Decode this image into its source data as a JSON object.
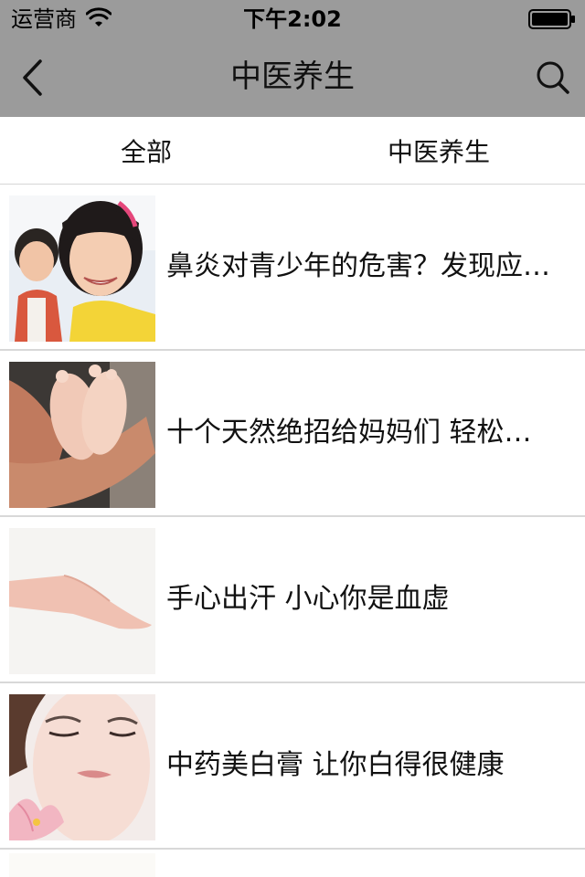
{
  "status_bar": {
    "carrier": "运营商",
    "time": "下午2:02"
  },
  "nav": {
    "title": "中医养生",
    "back_icon": "chevron-left-icon",
    "search_icon": "search-icon"
  },
  "tabs": [
    {
      "label": "全部"
    },
    {
      "label": "中医养生"
    }
  ],
  "articles": [
    {
      "title": "鼻炎对青少年的危害？发现应…",
      "thumbnail": "children-smiling"
    },
    {
      "title": "十个天然绝招给妈妈们 轻松…",
      "thumbnail": "baby-feet-in-hands"
    },
    {
      "title": "手心出汗 小心你是血虚",
      "thumbnail": "open-palm-hand"
    },
    {
      "title": "中药美白膏 让你白得很健康",
      "thumbnail": "woman-face-with-lily"
    }
  ],
  "colors": {
    "header_bg": "#9b9b9b",
    "divider": "#d8d8d8",
    "text": "#111111"
  }
}
